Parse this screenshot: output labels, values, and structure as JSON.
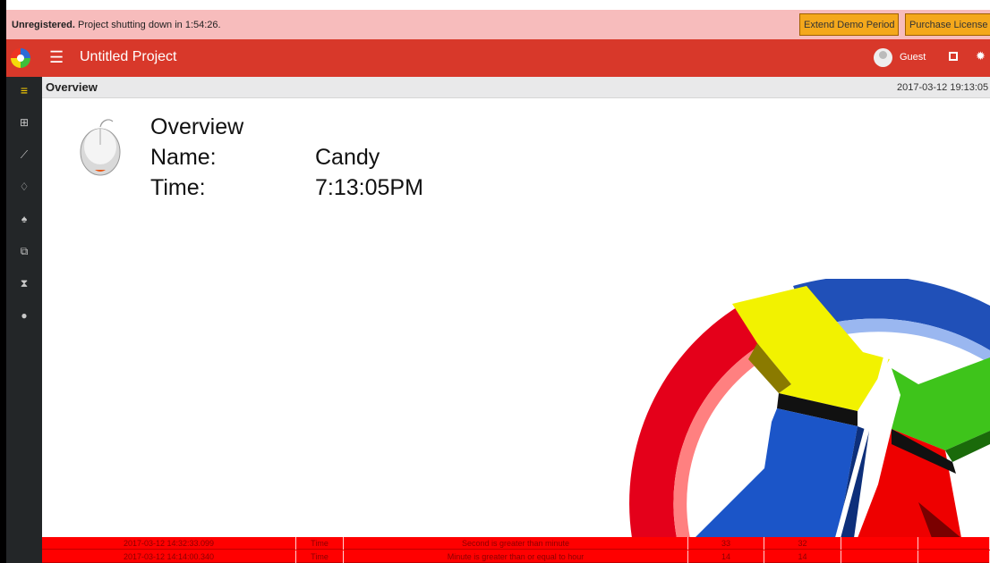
{
  "banner": {
    "bold": "Unregistered.",
    "message": " Project shutting down in 1:54:26.",
    "extend_button": "Extend Demo Period",
    "purchase_button": "Purchase License"
  },
  "header": {
    "menu_icon": "☰",
    "title": "Untitled Project",
    "user": "Guest",
    "gear_icon": "✹"
  },
  "sidebar": {
    "items": [
      {
        "icon": "menu-icon",
        "glyph": "≡"
      },
      {
        "icon": "map-icon",
        "glyph": "⊞"
      },
      {
        "icon": "chart-icon",
        "glyph": "⟋"
      },
      {
        "icon": "bell-outline-icon",
        "glyph": "♢"
      },
      {
        "icon": "bell-icon",
        "glyph": "♠"
      },
      {
        "icon": "copy-icon",
        "glyph": "⧉"
      },
      {
        "icon": "hourglass-icon",
        "glyph": "⧗"
      },
      {
        "icon": "info-icon",
        "glyph": "●"
      }
    ]
  },
  "strip": {
    "label": "Overview",
    "timestamp": "2017-03-12 19:13:05"
  },
  "content": {
    "title": "Overview",
    "name_label": "Name:",
    "name_value": "Candy",
    "time_label": "Time:",
    "time_value": "7:13:05PM"
  },
  "alarms": [
    [
      "2017-03-12 14:32:33.099",
      "Time",
      "Second is greater than minute",
      "33",
      "32",
      "",
      ""
    ],
    [
      "2017-03-12 14:14:00.340",
      "Time",
      "Minute is greater than or equal to hour",
      "14",
      "14",
      "",
      ""
    ]
  ],
  "colors": {
    "banner_bg": "#f7bcbc",
    "header_bg": "#d8382a",
    "sidebar_bg": "#232628",
    "alarm_bg": "#ff0000",
    "button_bg": "#f4a81c"
  }
}
